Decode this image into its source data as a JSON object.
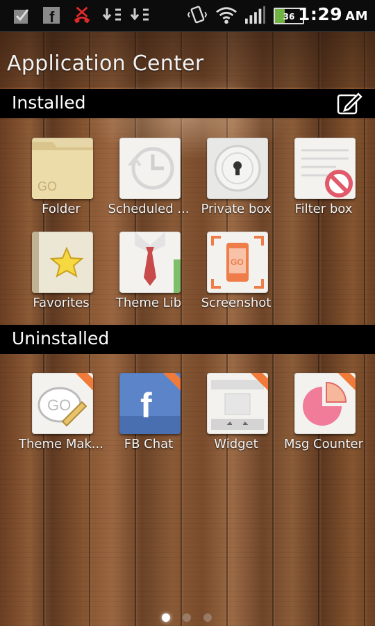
{
  "status_bar": {
    "time": "1:29",
    "ampm": "AM",
    "battery_level": "36",
    "icons": [
      "check-icon",
      "facebook-icon",
      "missed-call-icon",
      "download-icon",
      "download-icon",
      "vibrate-icon",
      "wifi-icon",
      "signal-icon",
      "battery-icon"
    ]
  },
  "header": {
    "title": "Application Center"
  },
  "installed": {
    "title": "Installed",
    "edit_icon": "edit-icon",
    "items": [
      {
        "label": "Folder",
        "icon": "folder-icon"
      },
      {
        "label": "Scheduled ...",
        "icon": "clock-icon"
      },
      {
        "label": "Private box",
        "icon": "lock-icon"
      },
      {
        "label": "Filter box",
        "icon": "filter-icon"
      },
      {
        "label": "Favorites",
        "icon": "star-icon"
      },
      {
        "label": "Theme Lib",
        "icon": "tie-icon"
      },
      {
        "label": "Screenshot",
        "icon": "screenshot-icon"
      }
    ]
  },
  "uninstalled": {
    "title": "Uninstalled",
    "items": [
      {
        "label": "Theme Mak...",
        "icon": "theme-maker-icon"
      },
      {
        "label": "FB Chat",
        "icon": "facebook-icon"
      },
      {
        "label": "Widget",
        "icon": "widget-icon"
      },
      {
        "label": "Msg Counter",
        "icon": "pie-chart-icon"
      }
    ]
  },
  "pager": {
    "count": 3,
    "active": 1
  }
}
